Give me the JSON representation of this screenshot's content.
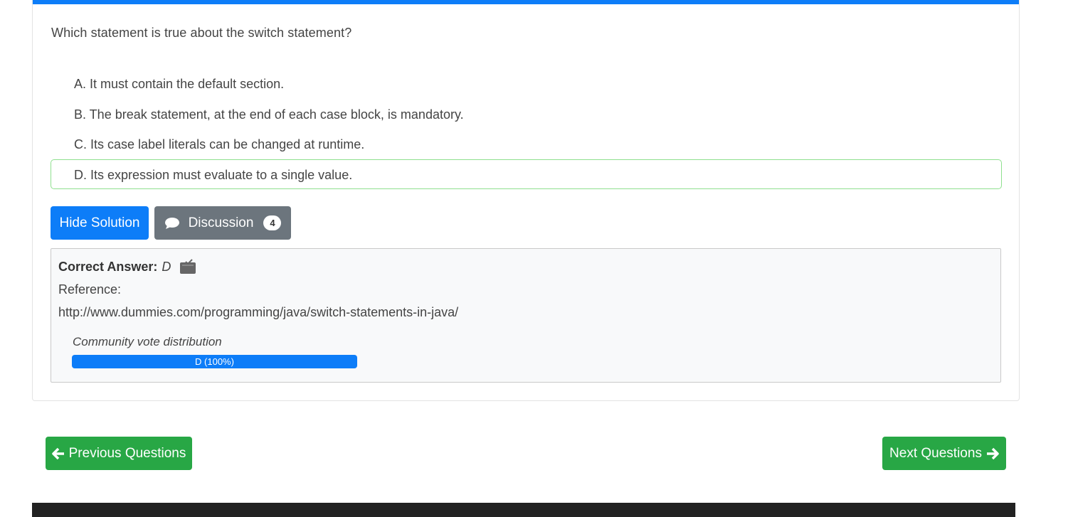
{
  "question": {
    "text": "Which statement is true about the switch statement?",
    "choices": [
      {
        "text": "A. It must contain the default section."
      },
      {
        "text": "B. The break statement, at the end of each case block, is mandatory."
      },
      {
        "text": "C. Its case label literals can be changed at runtime."
      },
      {
        "text": "D. Its expression must evaluate to a single value."
      }
    ]
  },
  "actions": {
    "hide_solution_label": "Hide Solution",
    "discussion_label": "Discussion",
    "discussion_count": "4"
  },
  "solution": {
    "correct_answer_label": "Correct Answer:",
    "correct_answer_value": "D",
    "reference_label": "Reference:",
    "reference_url": "http://www.dummies.com/programming/java/switch-statements-in-java/",
    "vote_title": "Community vote distribution",
    "vote_bar_label": "D (100%)",
    "vote_percent": 100
  },
  "navigation": {
    "previous_label": "Previous Questions",
    "next_label": "Next Questions"
  },
  "colors": {
    "primary": "#0d7df8",
    "secondary": "#6c757d",
    "success": "#28a745",
    "correct_border": "#8fe08f"
  },
  "icons": {
    "discussion": "chat-bubble-icon",
    "answer": "clipboard-check-icon",
    "previous": "arrow-left-icon",
    "next": "arrow-right-icon"
  }
}
